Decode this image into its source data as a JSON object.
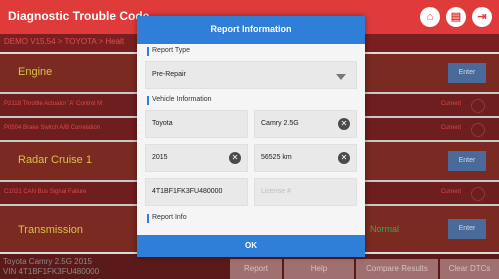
{
  "app": {
    "title": "Diagnostic Trouble Code",
    "breadcrumb": "DEMO V15.54 > TOYOTA > Healt",
    "icons": [
      "home-icon",
      "print-icon",
      "exit-icon"
    ]
  },
  "systems": [
    {
      "name": "Engine",
      "enter": "Enter"
    },
    {
      "name": "Radar Cruise 1",
      "enter": "Enter"
    },
    {
      "name": "Transmission",
      "enter": "Enter",
      "status": "Normal"
    }
  ],
  "dtcs": [
    {
      "text": "P2118 Throttle Actuator 'A' Control M",
      "state": "Current"
    },
    {
      "text": "P0504 Brake Switch A/B Correlation",
      "state": "Current"
    },
    {
      "text": "C1021 CAN Bus Signal Failure",
      "state": "Current"
    }
  ],
  "bottom": {
    "vehicle_line1": "Toyota Camry 2.5G 2015",
    "vehicle_line2": "VIN 4T1BF1FK3FU480000",
    "tabs": [
      "Report",
      "Help",
      "Compare Results",
      "Clear DTCs"
    ]
  },
  "dialog": {
    "title": "Report Information",
    "report_type_label": "Report Type",
    "report_type_value": "Pre-Repair",
    "vehicle_info_label": "Vehicle Information",
    "make": "Toyota",
    "model": "Camry 2.5G",
    "year": "2015",
    "mileage": "56525 km",
    "vin": "4T1BF1FK3FU480000",
    "license_placeholder": "License #",
    "report_info_label": "Report Info",
    "ok_label": "OK"
  }
}
